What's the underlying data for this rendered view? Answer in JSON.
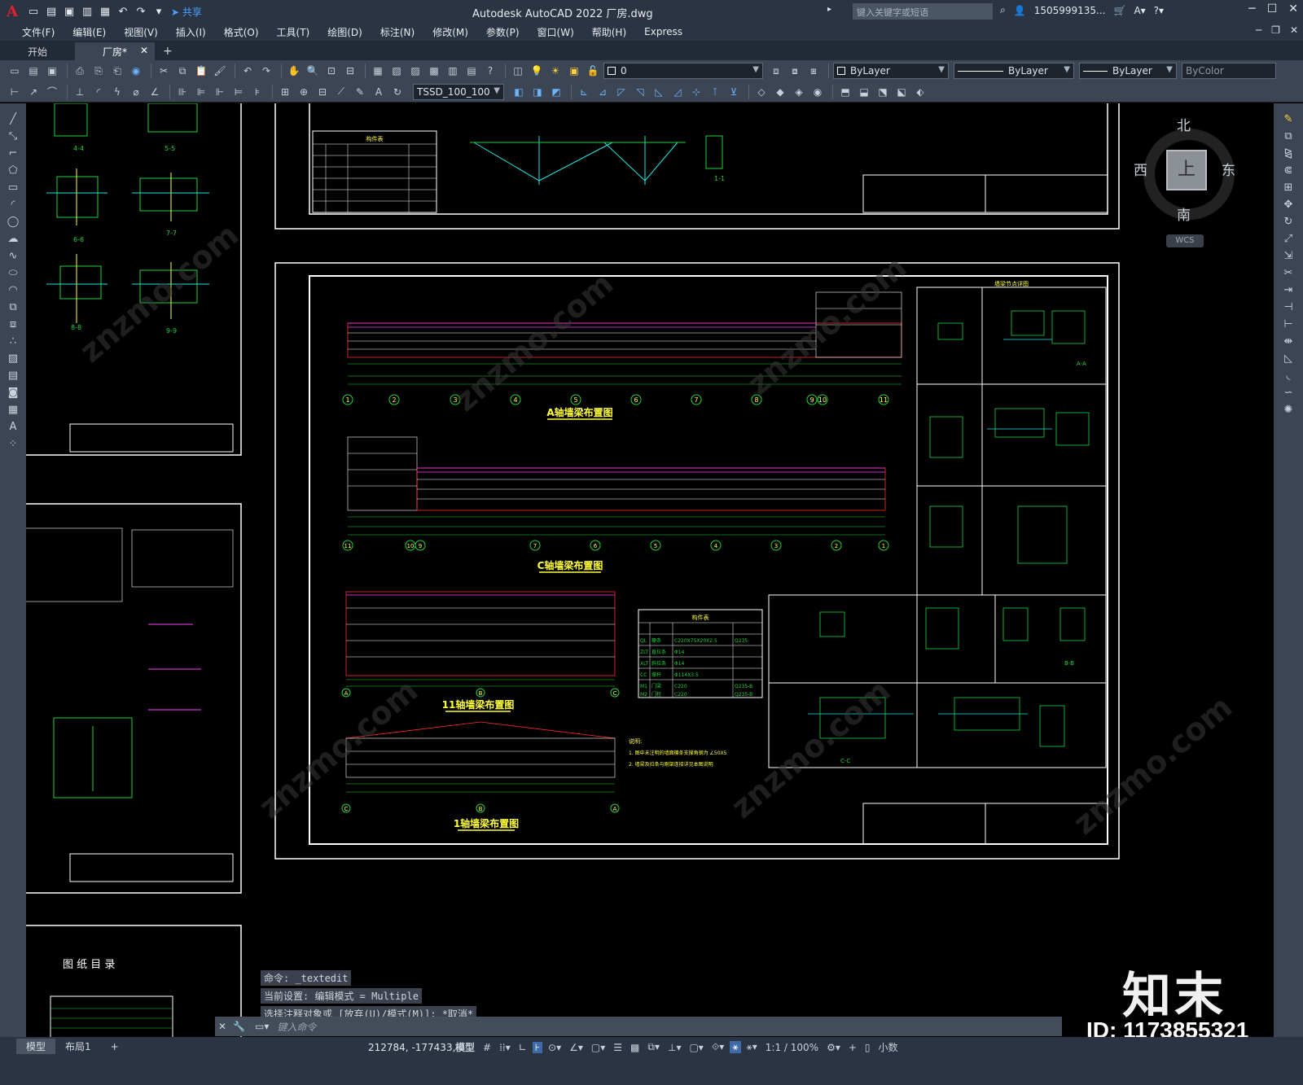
{
  "titlebar": {
    "app_title": "Autodesk AutoCAD 2022    厂房.dwg",
    "share_label": "共享",
    "search_placeholder": "键入关键字或短语",
    "user_name": "1505999135...",
    "logo_letter": "A"
  },
  "menu": {
    "items": [
      "文件(F)",
      "编辑(E)",
      "视图(V)",
      "插入(I)",
      "格式(O)",
      "工具(T)",
      "绘图(D)",
      "标注(N)",
      "修改(M)",
      "参数(P)",
      "窗口(W)",
      "帮助(H)",
      "Express"
    ]
  },
  "tabs": {
    "start": "开始",
    "doc": "厂房*"
  },
  "toolbar": {
    "layer_value": "0",
    "color_value": "ByLayer",
    "linetype_value": "ByLayer",
    "lineweight_value": "ByLayer",
    "plotstyle_value": "ByColor",
    "dimstyle_value": "TSSD_100_100"
  },
  "viewcube": {
    "north": "北",
    "south": "南",
    "east": "东",
    "west": "西",
    "face": "上",
    "wcs": "WCS"
  },
  "drawing": {
    "titles": {
      "a_axis": "A轴墙梁布置图",
      "c_axis": "C轴墙梁布置图",
      "axis_11": "11轴墙梁布置图",
      "axis_1": "1轴墙梁布置图",
      "index": "图 纸 目 录"
    },
    "notes_heading": "说明:",
    "notes": [
      "1. 图中未注明的墙面檩条支撑角钢为 ∠50X5",
      "2. 墙梁及拉条与刚架连接详见本图说明"
    ],
    "table_heading": "构件表",
    "table_rows": [
      [
        "QL",
        "檩条",
        "C220X75X20X2.5",
        "Q235"
      ],
      [
        "ZLT",
        "直拉条",
        "Φ14",
        ""
      ],
      [
        "XLT",
        "斜拉条",
        "Φ14",
        ""
      ],
      [
        "CC",
        "撑杆",
        "Φ114X3.5",
        ""
      ],
      [
        "M1",
        "门梁",
        "C220",
        "Q235-B"
      ],
      [
        "M2",
        "门柱",
        "C220",
        "Q235-B"
      ]
    ],
    "axis_a_labels": [
      "1",
      "2",
      "3",
      "4",
      "5",
      "6",
      "7",
      "8",
      "9",
      "10",
      "11"
    ],
    "axis_c_labels": [
      "11",
      "10",
      "9",
      "7",
      "6",
      "5",
      "4",
      "3",
      "2",
      "1"
    ],
    "axis_11_labels": [
      "A",
      "B",
      "C"
    ],
    "axis_1_labels": [
      "C",
      "B",
      "A"
    ],
    "node_title": "墙梁节点详图",
    "section_labels": [
      "4-4",
      "5-5",
      "6-6",
      "7-7",
      "8-8",
      "9-9",
      "1-1",
      "A-A",
      "B-B",
      "C-C"
    ]
  },
  "command": {
    "history": [
      "命令: _textedit",
      "当前设置: 编辑模式 = Multiple",
      "选择注释对象或 [放弃(U)/模式(M)]: *取消*"
    ],
    "placeholder": "键入命令"
  },
  "status": {
    "tab_model": "模型",
    "tab_layout": "布局1",
    "coords": "212784, -177433, 0",
    "model_label": "模型",
    "scale": "1:1 / 100%",
    "units": "小数"
  },
  "brand": {
    "name": "知末",
    "id": "ID: 1173855321"
  },
  "colors": {
    "ui_bg": "#2b3442",
    "toolbar_bg": "#3b4553",
    "canvas_bg": "#000000",
    "cad_green": "#1fd43b",
    "cad_magenta": "#ff3cff",
    "cad_cyan": "#21e6e6",
    "cad_yellow": "#ffff3c",
    "cad_red": "#ff2b2b"
  }
}
